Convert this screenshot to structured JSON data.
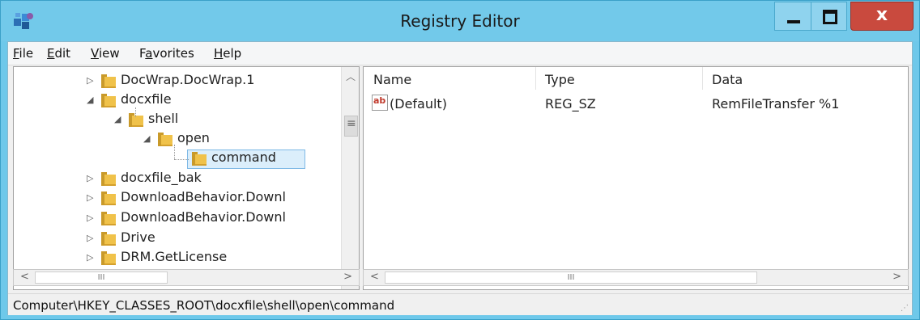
{
  "window": {
    "title": "Registry Editor",
    "close_glyph": "x"
  },
  "menu": [
    "File",
    "Edit",
    "View",
    "Favorites",
    "Help"
  ],
  "menu_mnemonics": [
    {
      "pre": "",
      "key": "F",
      "post": "ile"
    },
    {
      "pre": "",
      "key": "E",
      "post": "dit"
    },
    {
      "pre": "",
      "key": "V",
      "post": "iew"
    },
    {
      "pre": "F",
      "key": "a",
      "post": "vorites"
    },
    {
      "pre": "",
      "key": "H",
      "post": "elp"
    }
  ],
  "tree": {
    "items": [
      {
        "label": "DocWrap.DocWrap.1",
        "expanded": false
      },
      {
        "label": "docxfile",
        "expanded": true
      },
      {
        "label": "shell",
        "expanded": true
      },
      {
        "label": "open",
        "expanded": true
      },
      {
        "label": "command",
        "selected": true
      },
      {
        "label": "docxfile_bak",
        "expanded": false
      },
      {
        "label": "DownloadBehavior.Downl",
        "expanded": false
      },
      {
        "label": "DownloadBehavior.Downl",
        "expanded": false
      },
      {
        "label": "Drive",
        "expanded": false
      },
      {
        "label": "DRM.GetLicense",
        "expanded": false
      }
    ],
    "hscroll_thumb": "III"
  },
  "list": {
    "columns": [
      "Name",
      "Type",
      "Data"
    ],
    "rows": [
      {
        "icon": "string-value-icon",
        "icon_text": "ab",
        "name": "(Default)",
        "type": "REG_SZ",
        "data": "RemFileTransfer %1"
      }
    ],
    "hscroll_thumb": "III"
  },
  "status": {
    "path": "Computer\\HKEY_CLASSES_ROOT\\docxfile\\shell\\open\\command"
  },
  "colors": {
    "titlebar": "#72c9ea",
    "close": "#c94a3e",
    "selection": "#dbeefb"
  }
}
